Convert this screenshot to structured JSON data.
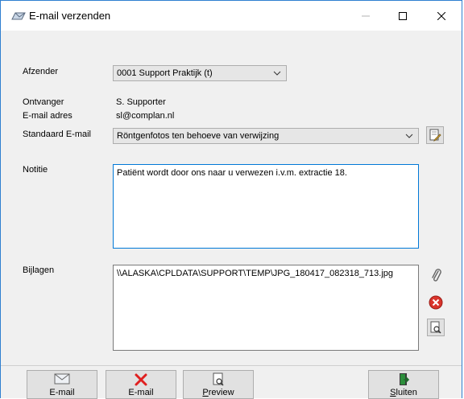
{
  "window": {
    "title": "E-mail verzenden"
  },
  "form": {
    "sender_label": "Afzender",
    "sender_value": "0001 Support Praktijk (t)",
    "recipient_label": "Ontvanger",
    "recipient_value": "S. Supporter",
    "email_label": "E-mail adres",
    "email_value": "sl@complan.nl",
    "template_label": "Standaard E-mail",
    "template_value": "Röntgenfotos ten behoeve van verwijzing",
    "note_label": "Notitie",
    "note_value": "Patiënt wordt door ons naar u verwezen i.v.m. extractie 18.",
    "attachments_label": "Bijlagen",
    "attachments": [
      "\\\\ALASKA\\CPLDATA\\SUPPORT\\TEMP\\JPG_180417_082318_713.jpg"
    ]
  },
  "buttons": {
    "email_send": "E-mail",
    "email_cancel": "E-mail",
    "preview_rest": "review",
    "preview_first": "P",
    "close_first": "S",
    "close_rest": "luiten"
  },
  "colors": {
    "accent": "#0078d7",
    "delete": "#d9342b"
  }
}
